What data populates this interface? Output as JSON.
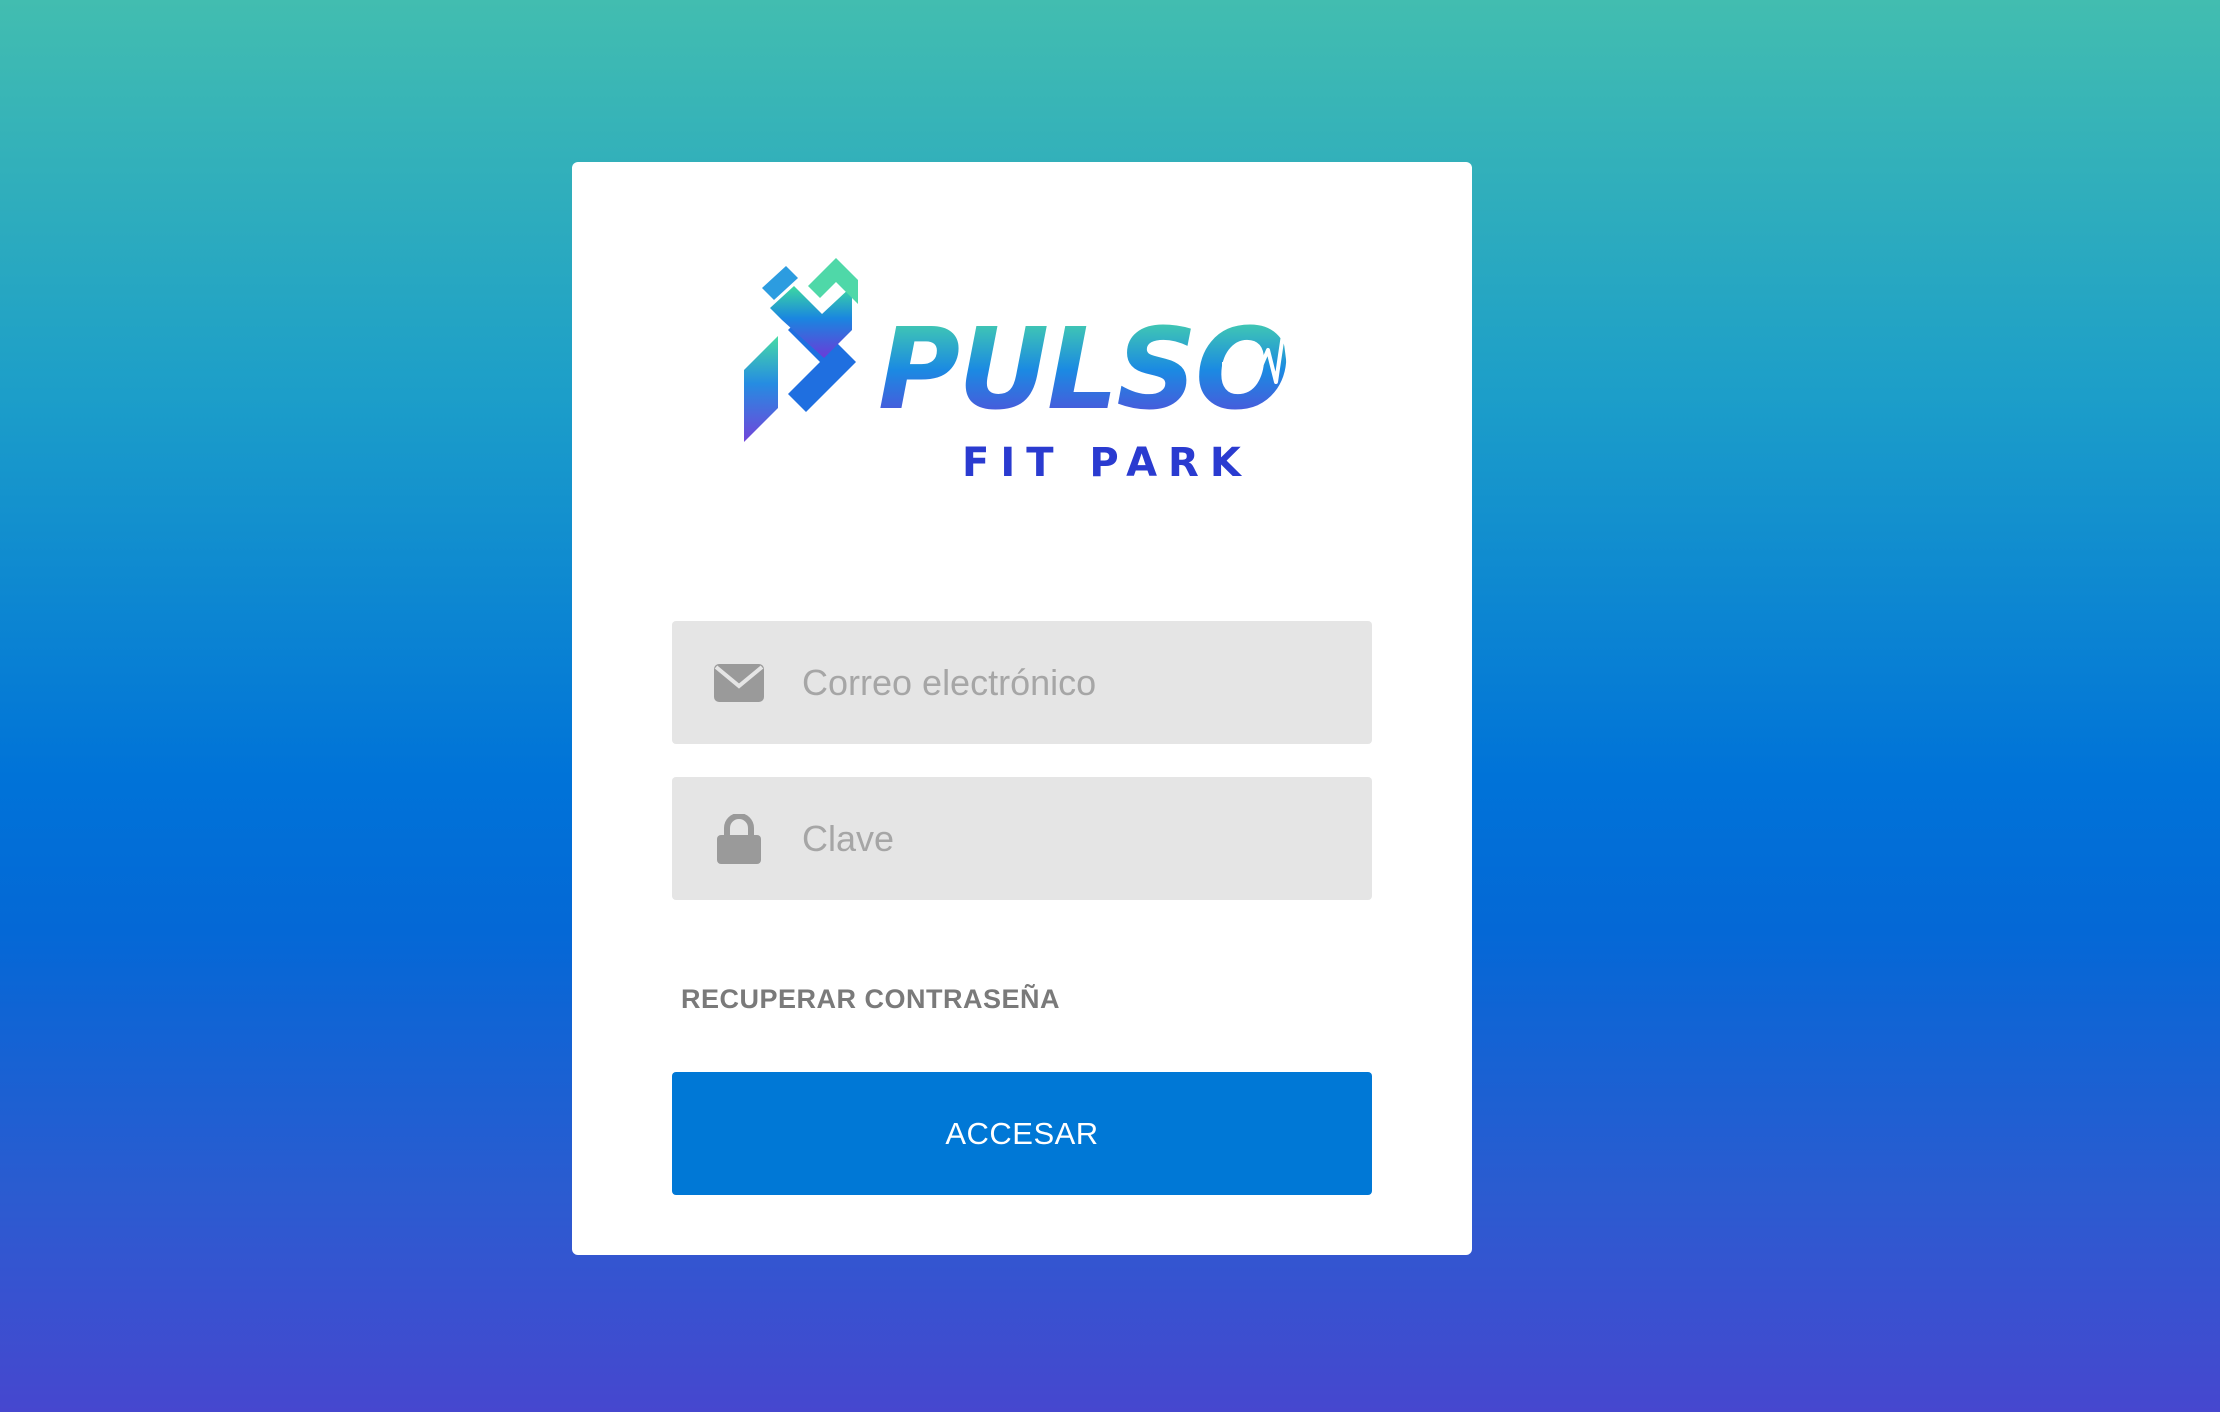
{
  "brand": {
    "name": "PULSO",
    "tagline": "FIT PARK",
    "logo_icon": "runner-arrow-logo",
    "colors": {
      "teal": "#3dd9a0",
      "blue": "#1f6fe0",
      "violet": "#6a3bd8",
      "navy": "#2a3bd0"
    }
  },
  "login": {
    "email": {
      "icon": "envelope-icon",
      "placeholder": "Correo electrónico",
      "value": ""
    },
    "password": {
      "icon": "lock-icon",
      "placeholder": "Clave",
      "value": ""
    },
    "recover_link": "RECUPERAR CONTRASEÑA",
    "submit_label": "ACCESAR"
  },
  "theme": {
    "button_color": "#0078d6",
    "field_background": "#e5e5e5",
    "background_top": "#42bdb0",
    "background_bottom": "#4647cf"
  }
}
